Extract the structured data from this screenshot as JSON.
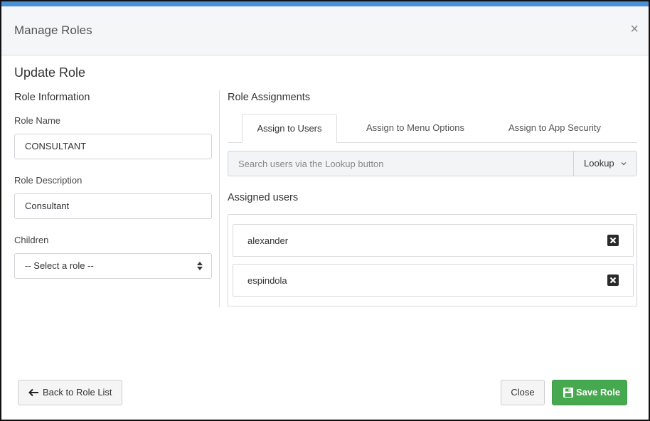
{
  "header": {
    "title": "Manage Roles",
    "close_glyph": "×"
  },
  "page_title": "Update Role",
  "role_info": {
    "section_title": "Role Information",
    "name_label": "Role Name",
    "name_value": "CONSULTANT",
    "description_label": "Role Description",
    "description_value": "Consultant",
    "children_label": "Children",
    "children_selected": "-- Select a role --"
  },
  "assignments": {
    "section_title": "Role Assignments",
    "tabs": [
      {
        "label": "Assign to Users",
        "active": true
      },
      {
        "label": "Assign to Menu Options",
        "active": false
      },
      {
        "label": "Assign to App Security",
        "active": false
      }
    ],
    "search_placeholder": "Search users via the Lookup button",
    "lookup_label": "Lookup",
    "assigned_title": "Assigned users",
    "users": [
      "alexander",
      "espindola"
    ]
  },
  "footer": {
    "back_label": "Back to Role List",
    "close_label": "Close",
    "save_label": "Save Role"
  },
  "colors": {
    "accent": "#4a90d9",
    "success": "#47a94f"
  },
  "icons": [
    "close-icon",
    "select-arrows-icon",
    "chevron-down-icon",
    "remove-icon",
    "arrow-left-icon",
    "floppy-disk-icon"
  ]
}
